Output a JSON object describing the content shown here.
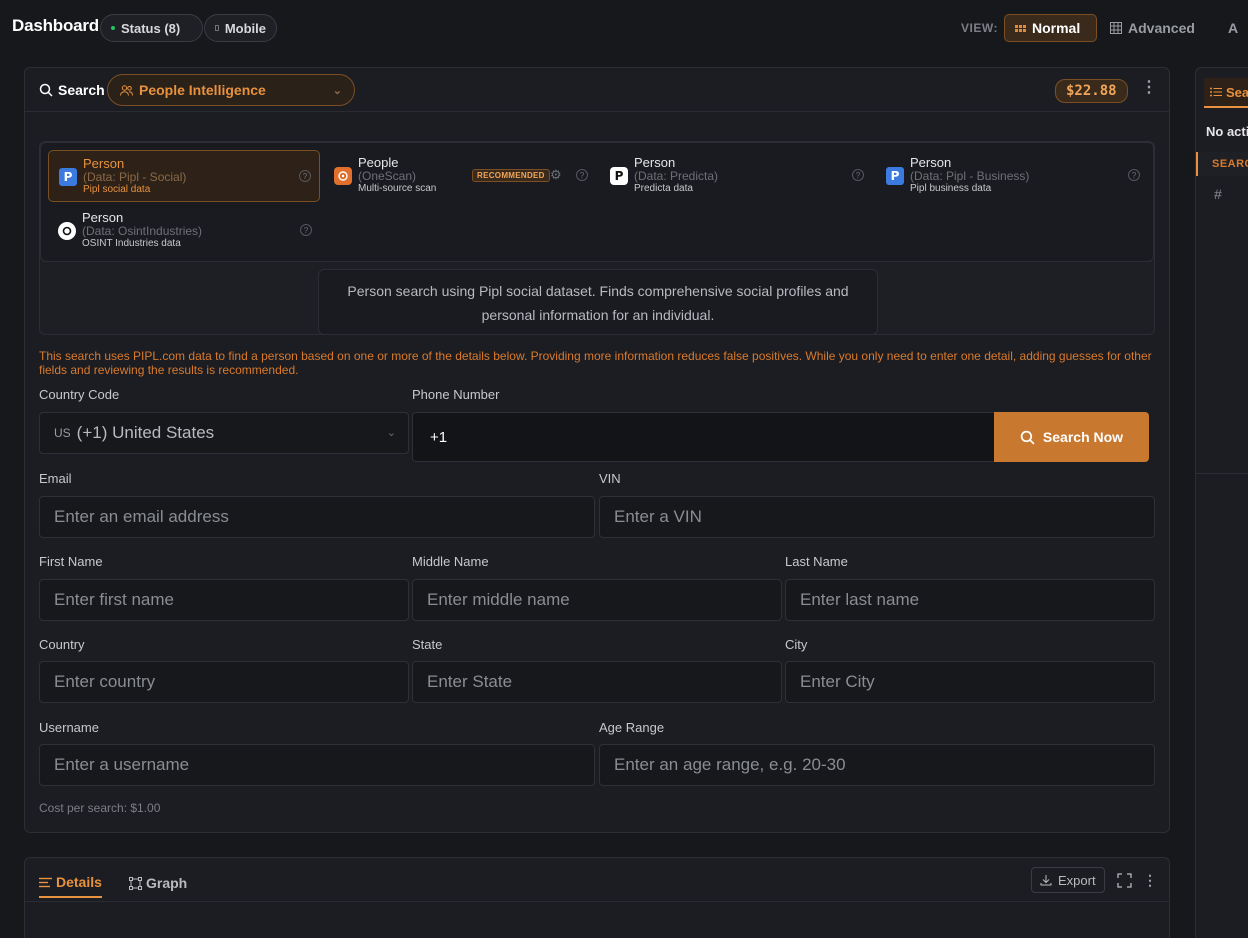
{
  "topbar": {
    "title": "Dashboard",
    "status_label": "Status (8)",
    "mobile_label": "Mobile",
    "view_label": "VIEW:",
    "views": [
      "Normal",
      "Advanced",
      "A"
    ]
  },
  "search_panel": {
    "search_label": "Search",
    "mode": "People Intelligence",
    "credit": "$22.88"
  },
  "sources": [
    {
      "name": "Person",
      "sub": "(Data: Pipl - Social)",
      "desc": "Pipl social data",
      "icon": "pipl-icon",
      "active": true
    },
    {
      "name": "People",
      "sub": "(OneScan)",
      "desc": "Multi-source scan",
      "icon": "onescan-icon",
      "badge": "RECOMMENDED"
    },
    {
      "name": "Person",
      "sub": "(Data: Predicta)",
      "desc": "Predicta data",
      "icon": "predicta-icon"
    },
    {
      "name": "Person",
      "sub": "(Data: Pipl - Business)",
      "desc": "Pipl business data",
      "icon": "pipl-icon"
    },
    {
      "name": "Person",
      "sub": "(Data: OsintIndustries)",
      "desc": "OSINT Industries data",
      "icon": "osint-industries-icon"
    }
  ],
  "source_description": "Person search using Pipl social dataset. Finds comprehensive social profiles and personal information for an individual.",
  "note": "This search uses PIPL.com data to find a person based on one or more of the details below. Providing more information reduces false positives. While you only need to enter one detail, adding guesses for other fields and reviewing the results is recommended.",
  "form": {
    "country_code": {
      "label": "Country Code",
      "code": "US",
      "value": "(+1) United States"
    },
    "phone": {
      "label": "Phone Number",
      "value": "+1"
    },
    "search_button": "Search Now",
    "email": {
      "label": "Email",
      "placeholder": "Enter an email address"
    },
    "vin": {
      "label": "VIN",
      "placeholder": "Enter a VIN"
    },
    "first_name": {
      "label": "First Name",
      "placeholder": "Enter first name"
    },
    "middle_name": {
      "label": "Middle Name",
      "placeholder": "Enter middle name"
    },
    "last_name": {
      "label": "Last Name",
      "placeholder": "Enter last name"
    },
    "country": {
      "label": "Country",
      "placeholder": "Enter country"
    },
    "state": {
      "label": "State",
      "placeholder": "Enter State"
    },
    "city": {
      "label": "City",
      "placeholder": "Enter City"
    },
    "username": {
      "label": "Username",
      "placeholder": "Enter a username"
    },
    "age_range": {
      "label": "Age Range",
      "placeholder": "Enter an age range, e.g. 20-30"
    },
    "cost": "Cost per search: $1.00"
  },
  "details_panel": {
    "tabs": [
      "Details",
      "Graph"
    ],
    "export_label": "Export"
  },
  "side_panel": {
    "tab_label": "Sea",
    "no_activity": "No acti",
    "header": "SEARC",
    "hash": "#"
  },
  "colors": {
    "accent": "#e8913e",
    "background": "#17181c",
    "panel": "#1c1d22"
  }
}
